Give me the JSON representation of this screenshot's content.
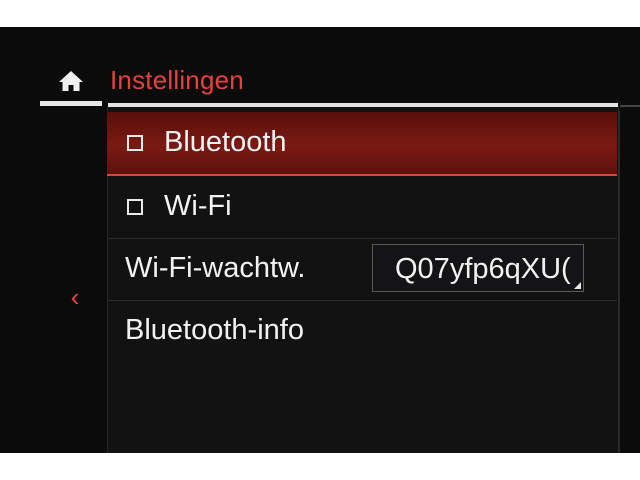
{
  "header": {
    "title": "Instellingen",
    "home_icon": "home-icon",
    "accent_color": "#e8413a"
  },
  "nav": {
    "back_icon": "chevron-left-icon",
    "back_glyph": "‹"
  },
  "menu": {
    "items": [
      {
        "label": "Bluetooth",
        "checked": false,
        "selected": true
      },
      {
        "label": "Wi-Fi",
        "checked": false,
        "selected": false
      },
      {
        "label": "Wi-Fi-wachtw.",
        "value": "Q07yfp6qXU("
      },
      {
        "label": "Bluetooth-info"
      }
    ]
  }
}
